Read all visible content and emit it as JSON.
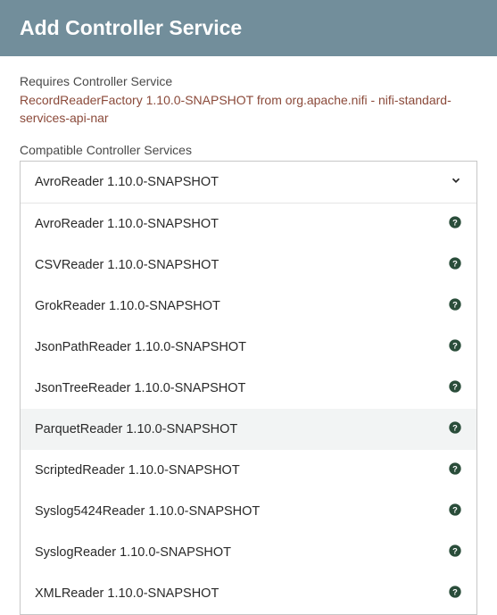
{
  "dialog": {
    "title": "Add Controller Service",
    "requires_label": "Requires Controller Service",
    "requires_value": "RecordReaderFactory 1.10.0-SNAPSHOT from org.apache.nifi - nifi-standard-services-api-nar",
    "compatible_label": "Compatible Controller Services",
    "selected": "AvroReader 1.10.0-SNAPSHOT",
    "options": [
      {
        "label": "AvroReader 1.10.0-SNAPSHOT",
        "highlighted": false
      },
      {
        "label": "CSVReader 1.10.0-SNAPSHOT",
        "highlighted": false
      },
      {
        "label": "GrokReader 1.10.0-SNAPSHOT",
        "highlighted": false
      },
      {
        "label": "JsonPathReader 1.10.0-SNAPSHOT",
        "highlighted": false
      },
      {
        "label": "JsonTreeReader 1.10.0-SNAPSHOT",
        "highlighted": false
      },
      {
        "label": "ParquetReader 1.10.0-SNAPSHOT",
        "highlighted": true
      },
      {
        "label": "ScriptedReader 1.10.0-SNAPSHOT",
        "highlighted": false
      },
      {
        "label": "Syslog5424Reader 1.10.0-SNAPSHOT",
        "highlighted": false
      },
      {
        "label": "SyslogReader 1.10.0-SNAPSHOT",
        "highlighted": false
      },
      {
        "label": "XMLReader 1.10.0-SNAPSHOT",
        "highlighted": false
      }
    ]
  }
}
